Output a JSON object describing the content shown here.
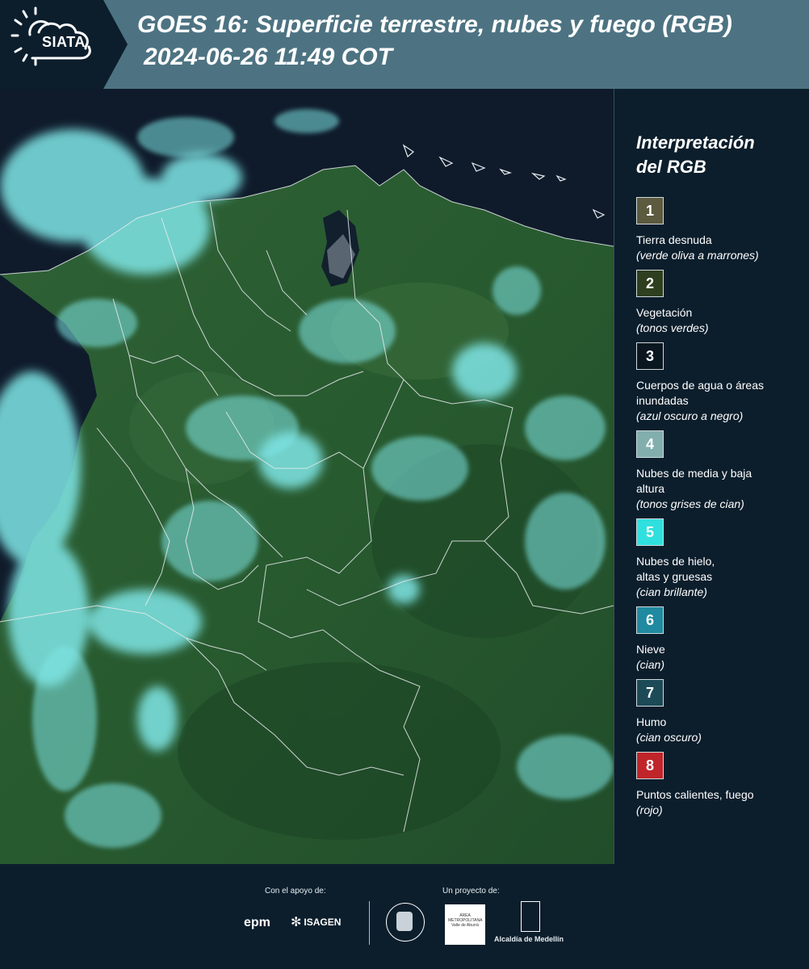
{
  "header": {
    "logo_text": "SIATA",
    "title_line1": "GOES 16: Superficie terrestre, nubes y fuego (RGB)",
    "title_line2": "2024-06-26 11:49 COT"
  },
  "legend": {
    "title_line1": "Interpretación",
    "title_line2": "del RGB",
    "items": [
      {
        "number": "1",
        "color": "#5c5a3f",
        "label": "Tierra desnuda",
        "note": "(verde oliva a marrones)"
      },
      {
        "number": "2",
        "color": "#2e3f1f",
        "label": "Vegetación",
        "note": "(tonos verdes)"
      },
      {
        "number": "3",
        "color": "#0b1720",
        "label": "Cuerpos de agua o áreas inundadas",
        "note": "(azul oscuro a negro)"
      },
      {
        "number": "4",
        "color": "#82aeae",
        "label": "Nubes de media y baja altura",
        "note": "(tonos grises de cian)"
      },
      {
        "number": "5",
        "color": "#2fe0de",
        "label": "Nubes de hielo, altas y gruesas",
        "note": "(cian brillante)"
      },
      {
        "number": "6",
        "color": "#1f8aa0",
        "label": "Nieve",
        "note": "(cian)"
      },
      {
        "number": "7",
        "color": "#1c4b57",
        "label": "Humo",
        "note": "(cian oscuro)"
      },
      {
        "number": "8",
        "color": "#c0252a",
        "label": "Puntos calientes, fuego",
        "note": "(rojo)"
      }
    ]
  },
  "footer": {
    "support_label": "Con el apoyo de:",
    "project_label": "Un proyecto de:",
    "sponsor1": "epm",
    "sponsor2": "ISAGEN",
    "partner1": "ÁREA METROPOLITANA Valle de Aburrá",
    "partner2": "Alcaldía de Medellín"
  },
  "colors": {
    "header_bg": "#4d7382",
    "page_bg": "#0c1e2c",
    "ocean": "#0e1a2a",
    "land": "#2c5a32",
    "cloud": "#7fe6e6",
    "border": "#e8ecef"
  }
}
